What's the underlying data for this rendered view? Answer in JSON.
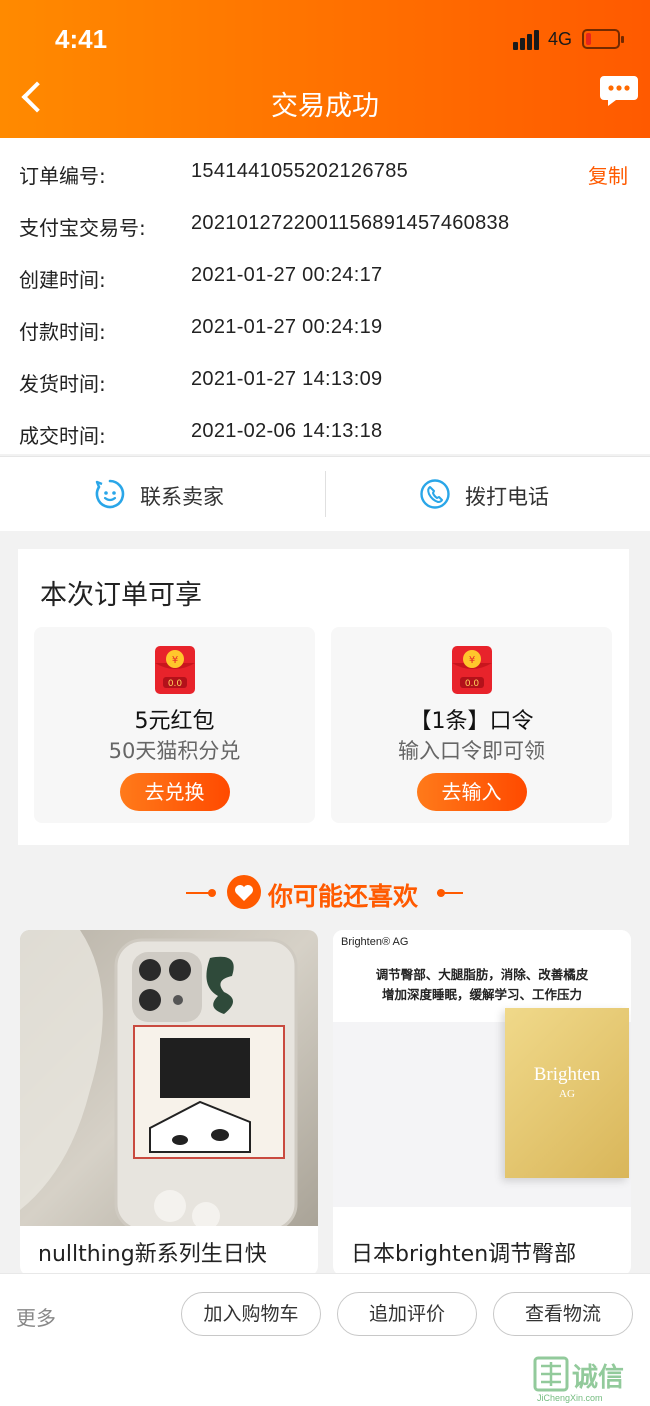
{
  "status_bar": {
    "time": "4:41",
    "network": "4G"
  },
  "header": {
    "title": "交易成功"
  },
  "order_info": {
    "copy_label": "复制",
    "rows": [
      {
        "label": "订单编号:",
        "value": "1541441055202126785"
      },
      {
        "label": "支付宝交易号:",
        "value": "2021012722001156891457460838"
      },
      {
        "label": "创建时间:",
        "value": "2021-01-27 00:24:17"
      },
      {
        "label": "付款时间:",
        "value": "2021-01-27 00:24:19"
      },
      {
        "label": "发货时间:",
        "value": "2021-01-27 14:13:09"
      },
      {
        "label": "成交时间:",
        "value": "2021-02-06 14:13:18"
      }
    ]
  },
  "contact": {
    "seller_label": "联系卖家",
    "phone_label": "拨打电话"
  },
  "benefits": {
    "title": "本次订单可享",
    "items": [
      {
        "title": "5元红包",
        "subtitle": "50天猫积分兑",
        "button": "去兑换"
      },
      {
        "title": "【1条】口令",
        "subtitle": "输入口令即可领",
        "button": "去输入"
      }
    ]
  },
  "recommend": {
    "title": "你可能还喜欢",
    "products": [
      {
        "title": "nullthing新系列生日快"
      },
      {
        "title": "日本brighten调节臀部",
        "brand": "Brighten® AG",
        "headline_1": "调节臀部、大腿脂肪，消除、改善橘皮",
        "headline_2": "增加深度睡眠，缓解学习、工作压力",
        "box_text": "Brighten",
        "box_sub": "AG"
      }
    ]
  },
  "bottom_bar": {
    "more_label": "更多",
    "add_cart": "加入购物车",
    "add_review": "追加评价",
    "view_logistics": "查看物流"
  },
  "watermark": {
    "text": "诚信",
    "url": "JiChengXin.com"
  },
  "colors": {
    "accent": "#ff5a00",
    "header_start": "#ff8a00"
  }
}
